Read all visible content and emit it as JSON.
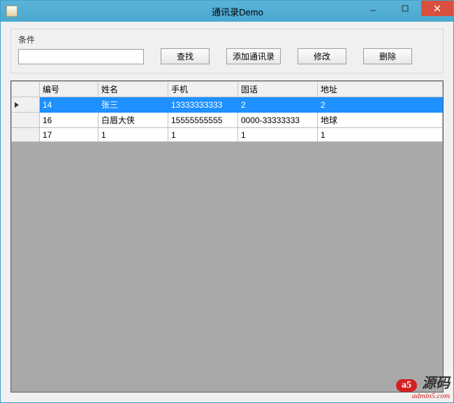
{
  "window": {
    "title": "通讯录Demo"
  },
  "toolbar": {
    "condition_label": "条件",
    "search_value": "",
    "search_btn": "查找",
    "add_btn": "添加通讯录",
    "edit_btn": "修改",
    "delete_btn": "删除"
  },
  "grid": {
    "headers": [
      "编号",
      "姓名",
      "手机",
      "固话",
      "地址"
    ],
    "rows": [
      {
        "selected": true,
        "cells": [
          "14",
          "张三",
          "13333333333",
          "2",
          "2"
        ]
      },
      {
        "selected": false,
        "cells": [
          "16",
          "白眉大侠",
          "15555555555",
          "0000-33333333",
          "地球"
        ]
      },
      {
        "selected": false,
        "cells": [
          "17",
          "1",
          "1",
          "1",
          "1"
        ]
      }
    ]
  },
  "watermark": {
    "badge": "a5",
    "text": "源码",
    "url": "admin5.com"
  }
}
